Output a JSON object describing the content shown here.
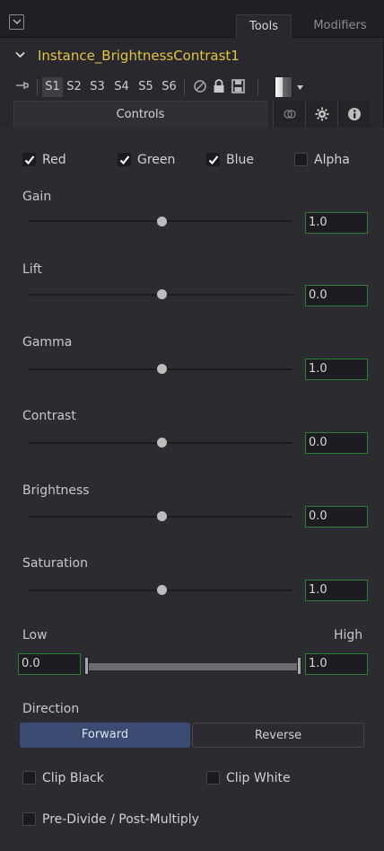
{
  "tabs": {
    "tools": "Tools",
    "modifiers": "Modifiers"
  },
  "tool": {
    "title": "Instance_BrightnessContrast1",
    "title_color": "#e3c542"
  },
  "toolbar": {
    "slots": [
      "S1",
      "S2",
      "S3",
      "S4",
      "S5",
      "S6"
    ],
    "active_slot": "S1",
    "icons": [
      "pin-icon",
      "disable-icon",
      "lock-icon",
      "save-icon",
      "color-swatch-icon"
    ]
  },
  "subtabs": {
    "controls": "Controls",
    "icons": [
      "link-icon",
      "gear-icon",
      "info-icon"
    ]
  },
  "channels": [
    {
      "label": "Red",
      "checked": true
    },
    {
      "label": "Green",
      "checked": true
    },
    {
      "label": "Blue",
      "checked": true
    },
    {
      "label": "Alpha",
      "checked": false
    }
  ],
  "params": [
    {
      "label": "Gain",
      "value": "1.0"
    },
    {
      "label": "Lift",
      "value": "0.0"
    },
    {
      "label": "Gamma",
      "value": "1.0"
    },
    {
      "label": "Contrast",
      "value": "0.0"
    },
    {
      "label": "Brightness",
      "value": "0.0"
    },
    {
      "label": "Saturation",
      "value": "1.0"
    }
  ],
  "range": {
    "low_label": "Low",
    "high_label": "High",
    "low_value": "0.0",
    "high_value": "1.0"
  },
  "direction": {
    "label": "Direction",
    "forward": "Forward",
    "reverse": "Reverse",
    "selected": "Forward"
  },
  "options": [
    {
      "label": "Clip Black",
      "checked": false
    },
    {
      "label": "Clip White",
      "checked": false
    },
    {
      "label": "Pre-Divide / Post-Multiply",
      "checked": false
    }
  ],
  "colors": {
    "accent_value_border": "#2f7d35",
    "selected_button": "#3b4a70"
  }
}
